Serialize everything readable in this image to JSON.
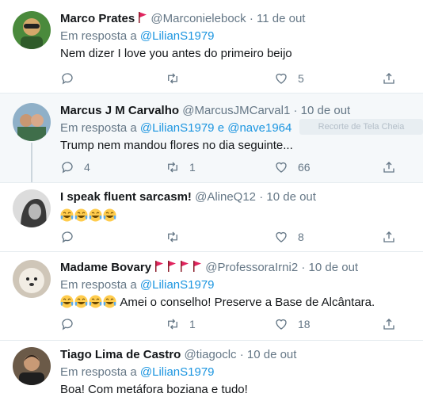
{
  "tweets": [
    {
      "name": "Marco Prates",
      "flags": 1,
      "handle": "@Marconielebock",
      "dot": "·",
      "time": "11 de out",
      "reply_prefix": "Em resposta a",
      "reply_to": "@LilianS1979",
      "reply_and": "",
      "reply_to2": "",
      "text": "Nem dizer I love you antes do primeiro beijo",
      "emojis": 0,
      "counts": {
        "reply": "",
        "retweet": "",
        "like": "5"
      }
    },
    {
      "name": "Marcus J M Carvalho",
      "flags": 0,
      "handle": "@MarcusJMCarval1",
      "dot": "·",
      "time": "10 de out",
      "reply_prefix": "Em resposta a",
      "reply_to": "@LilianS1979",
      "reply_and": "e",
      "reply_to2": "@nave1964",
      "text": "Trump nem mandou flores no dia seguinte...",
      "emojis": 0,
      "counts": {
        "reply": "4",
        "retweet": "1",
        "like": "66"
      }
    },
    {
      "name": "I speak fluent sarcasm!",
      "flags": 0,
      "handle": "@AlineQ12",
      "dot": "·",
      "time": "10 de out",
      "reply_prefix": "",
      "reply_to": "",
      "reply_and": "",
      "reply_to2": "",
      "text": "",
      "emojis": 4,
      "counts": {
        "reply": "",
        "retweet": "",
        "like": "8"
      }
    },
    {
      "name": "Madame Bovary",
      "flags": 4,
      "handle": "@ProfessoraIrni2",
      "dot": "·",
      "time": "10 de out",
      "reply_prefix": "Em resposta a",
      "reply_to": "@LilianS1979",
      "reply_and": "",
      "reply_to2": "",
      "text": "Amei o conselho! Preserve a Base de Alcântara.",
      "emojis": 4,
      "counts": {
        "reply": "",
        "retweet": "1",
        "like": "18"
      }
    },
    {
      "name": "Tiago Lima de Castro",
      "flags": 0,
      "handle": "@tiagoclc",
      "dot": "·",
      "time": "10 de out",
      "reply_prefix": "Em resposta a",
      "reply_to": "@LilianS1979",
      "reply_and": "",
      "reply_to2": "",
      "text": "Boa! Com metáfora boziana e tudo!",
      "emojis": 0,
      "counts": {
        "reply": "",
        "retweet": "",
        "like": ""
      }
    }
  ],
  "tooltip": "Recorte de Tela Cheia",
  "colors": {
    "link": "#1b95e0",
    "muted": "#657786",
    "flag": "#e0245e",
    "highlight": "#f5f8fa"
  },
  "icons": {
    "reply": "reply-icon",
    "retweet": "retweet-icon",
    "like": "heart-icon",
    "share": "share-icon",
    "emoji": "laughing-tears-emoji-icon",
    "flag": "red-flag-icon"
  }
}
